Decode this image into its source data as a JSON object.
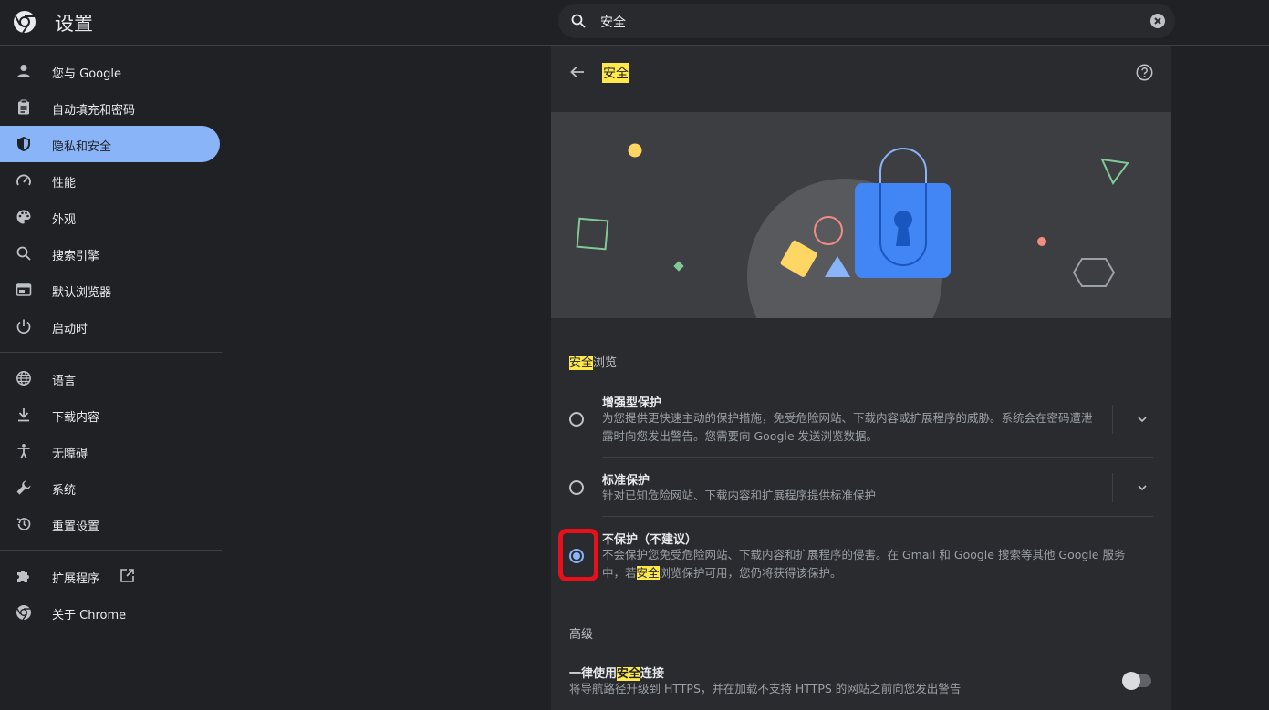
{
  "header": {
    "app_title": "设置",
    "search_value": "安全"
  },
  "sidebar": {
    "items": [
      {
        "label": "您与 Google",
        "icon": "person-icon"
      },
      {
        "label": "自动填充和密码",
        "icon": "clipboard-icon"
      },
      {
        "label": "隐私和安全",
        "icon": "shield-icon",
        "active": true
      },
      {
        "label": "性能",
        "icon": "gauge-icon"
      },
      {
        "label": "外观",
        "icon": "palette-icon"
      },
      {
        "label": "搜索引擎",
        "icon": "search-icon"
      },
      {
        "label": "默认浏览器",
        "icon": "browser-window-icon"
      },
      {
        "label": "启动时",
        "icon": "power-icon"
      },
      {
        "label": "语言",
        "icon": "globe-icon"
      },
      {
        "label": "下载内容",
        "icon": "download-icon"
      },
      {
        "label": "无障碍",
        "icon": "accessibility-icon"
      },
      {
        "label": "系统",
        "icon": "wrench-icon"
      },
      {
        "label": "重置设置",
        "icon": "reset-history-icon"
      },
      {
        "label": "扩展程序",
        "icon": "puzzle-icon"
      },
      {
        "label": "关于 Chrome",
        "icon": "chrome-logo-icon"
      }
    ]
  },
  "card": {
    "title": "安全",
    "safe_browsing": {
      "section_title_highlight": "安全",
      "section_title_rest": "浏览",
      "options": [
        {
          "title": "增强型保护",
          "desc": "为您提供更快速主动的保护措施，免受危险网站、下载内容或扩展程序的威胁。系统会在密码遭泄露时向您发出警告。您需要向 Google 发送浏览数据。",
          "selected": false
        },
        {
          "title": "标准保护",
          "desc": "针对已知危险网站、下载内容和扩展程序提供标准保护",
          "selected": false
        },
        {
          "title": "不保护（不建议）",
          "desc_before": "不会保护您免受危险网站、下载内容和扩展程序的侵害。在 Gmail 和 Google 搜索等其他 Google 服务中，若",
          "desc_highlight": "安全",
          "desc_after": "浏览保护可用，您仍将获得该保护。",
          "selected": true
        }
      ]
    },
    "advanced": {
      "section_title": "高级",
      "https_title_before": "一律使用",
      "https_title_highlight": "安全",
      "https_title_after": "连接",
      "https_desc": "将导航路径升级到 HTTPS，并在加载不支持 HTTPS 的网站之前向您发出警告",
      "https_enabled": false
    }
  },
  "colors": {
    "accent": "#8ab4f8",
    "highlight": "#ffe84a",
    "annotation_red": "#e8101a"
  }
}
